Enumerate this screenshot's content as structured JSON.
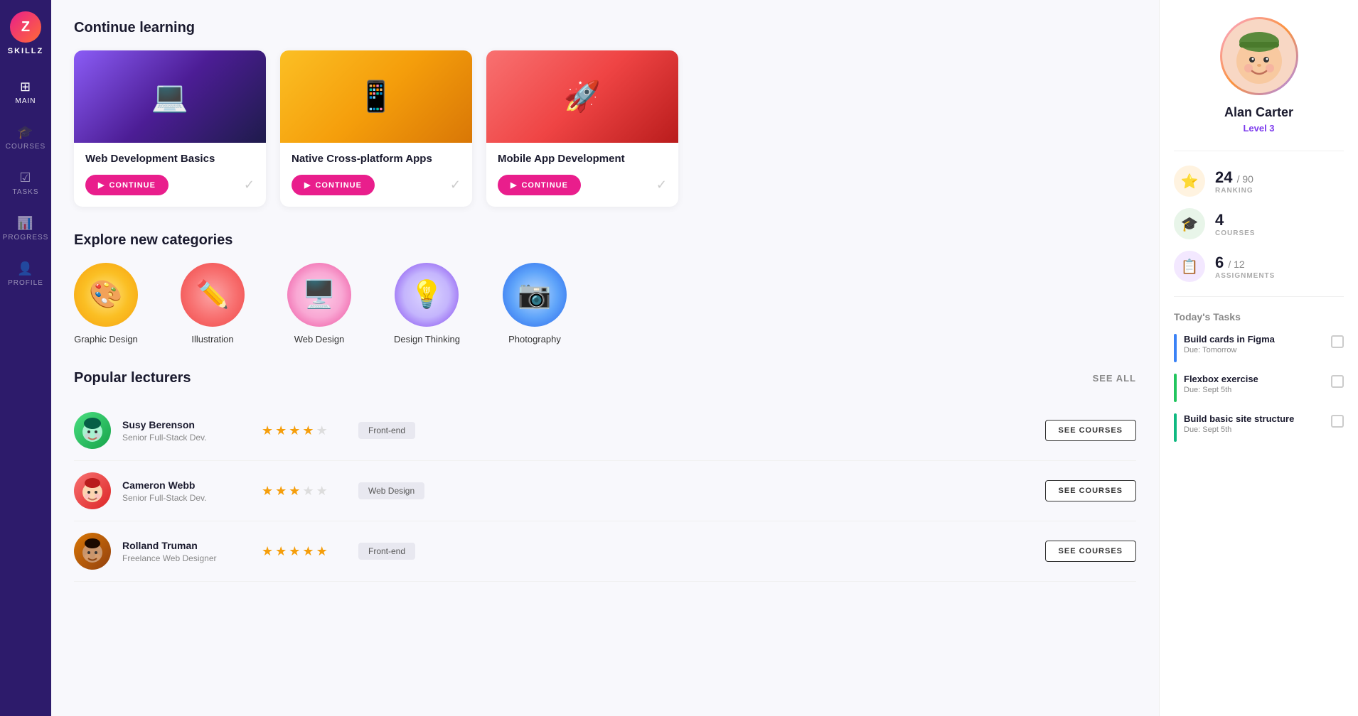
{
  "app": {
    "name": "SKILLZ",
    "logo": "Z"
  },
  "sidebar": {
    "items": [
      {
        "id": "main",
        "label": "MAIN",
        "icon": "⊞",
        "active": true
      },
      {
        "id": "courses",
        "label": "COURSES",
        "icon": "🎓"
      },
      {
        "id": "tasks",
        "label": "TASKS",
        "icon": "☑"
      },
      {
        "id": "progress",
        "label": "PROGRESS",
        "icon": "📊"
      },
      {
        "id": "profile",
        "label": "PROFILE",
        "icon": "👤"
      }
    ]
  },
  "continue_learning": {
    "title": "Continue learning",
    "courses": [
      {
        "id": 1,
        "title": "Web Development Basics",
        "theme": "purple",
        "emoji": "💻",
        "button": "CONTINUE"
      },
      {
        "id": 2,
        "title": "Native Cross-platform Apps",
        "theme": "yellow",
        "emoji": "📱",
        "button": "CONTINUE"
      },
      {
        "id": 3,
        "title": "Mobile App Development",
        "theme": "red",
        "emoji": "🚀",
        "button": "CONTINUE"
      }
    ]
  },
  "explore_categories": {
    "title": "Explore new categories",
    "categories": [
      {
        "id": "graphic-design",
        "label": "Graphic Design",
        "emoji": "🎨",
        "theme": "cat-yellow"
      },
      {
        "id": "illustration",
        "label": "Illustration",
        "emoji": "✏️",
        "theme": "cat-red"
      },
      {
        "id": "web-design",
        "label": "Web Design",
        "emoji": "🖥️",
        "theme": "cat-pink"
      },
      {
        "id": "design-thinking",
        "label": "Design Thinking",
        "emoji": "💡",
        "theme": "cat-purple"
      },
      {
        "id": "photography",
        "label": "Photography",
        "emoji": "📷",
        "theme": "cat-blue"
      }
    ]
  },
  "popular_lecturers": {
    "title": "Popular lecturers",
    "see_all": "SEE ALL",
    "lecturers": [
      {
        "id": 1,
        "name": "Susy Berenson",
        "title": "Senior Full-Stack Dev.",
        "stars": 4.5,
        "tag": "Front-end",
        "avatar_theme": "av-green",
        "avatar_emoji": "👩",
        "button": "SEE COURSES"
      },
      {
        "id": 2,
        "name": "Cameron Webb",
        "title": "Senior Full-Stack Dev.",
        "stars": 3.5,
        "tag": "Web Design",
        "avatar_theme": "av-red",
        "avatar_emoji": "👦",
        "button": "SEE COURSES"
      },
      {
        "id": 3,
        "name": "Rolland Truman",
        "title": "Freelance Web Designer",
        "stars": 5,
        "tag": "Front-end",
        "avatar_theme": "av-brown",
        "avatar_emoji": "🧑",
        "button": "SEE COURSES"
      }
    ]
  },
  "right_panel": {
    "profile": {
      "name": "Alan Carter",
      "level": "Level 3",
      "avatar_emoji": "🧒"
    },
    "stats": [
      {
        "id": "ranking",
        "value": "24",
        "total": "90",
        "label": "RANKING",
        "icon": "⭐",
        "theme": "stat-orange"
      },
      {
        "id": "courses",
        "value": "4",
        "total": "",
        "label": "COURSES",
        "icon": "🎓",
        "theme": "stat-green"
      },
      {
        "id": "assignments",
        "value": "6",
        "total": "12",
        "label": "ASSIGNMENTS",
        "icon": "📋",
        "theme": "stat-purple"
      }
    ],
    "tasks": {
      "title": "Today's tasks",
      "items": [
        {
          "id": 1,
          "name": "Build cards in Figma",
          "due": "Due: Tomorrow",
          "bar_color": "blue",
          "checked": false
        },
        {
          "id": 2,
          "name": "Flexbox exercise",
          "due": "Due: Sept 5th",
          "bar_color": "green",
          "checked": false
        },
        {
          "id": 3,
          "name": "Build basic site structure",
          "due": "Due: Sept 5th",
          "bar_color": "green2",
          "checked": false
        }
      ]
    }
  }
}
